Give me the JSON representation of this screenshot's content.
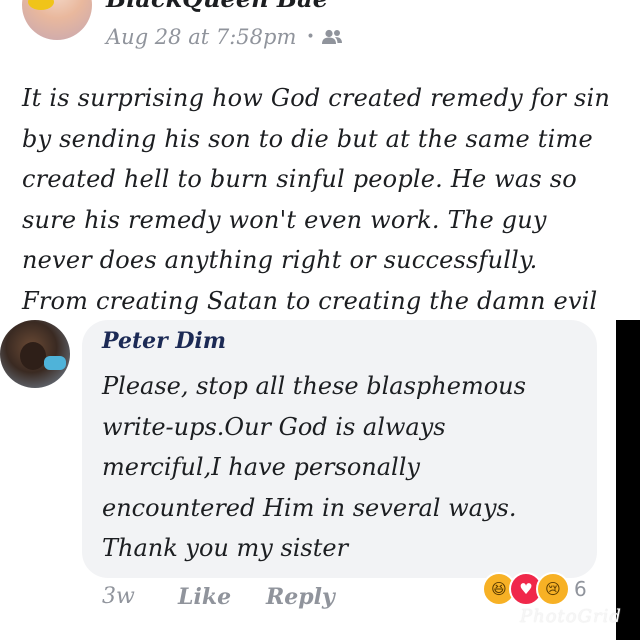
{
  "post": {
    "author": "BlackQueen Bae",
    "timestamp": "Aug 28 at 7:58pm",
    "separator": "•",
    "audience_icon": "friends-icon",
    "body_lines": [
      "It is surprising how God created remedy for sin",
      "by sending his son to die but at the same time",
      "created hell to burn sinful people. He was so",
      "sure his remedy won't even work. The guy",
      "never does anything right or successfully.",
      "From creating Satan to creating the damn evil"
    ]
  },
  "comment": {
    "author": "Peter Dim",
    "text_lines": [
      "Please, stop all these blasphemous",
      "write-ups.Our God is always",
      "merciful,I have personally",
      "encountered Him in several ways.",
      "Thank you my sister"
    ],
    "time": "3w",
    "like_label": "Like",
    "reply_label": "Reply",
    "reactions": {
      "icons": [
        "haha",
        "love",
        "sad"
      ],
      "glyphs": [
        "😆",
        "♥",
        "😢"
      ],
      "count": "6"
    }
  },
  "watermark": "PhotoGrid",
  "colors": {
    "meta_gray": "#90949c",
    "bubble_bg": "#f2f3f5",
    "author_navy": "#1c2a55",
    "love_red": "#f0284a",
    "reaction_yellow": "#f7b125"
  }
}
